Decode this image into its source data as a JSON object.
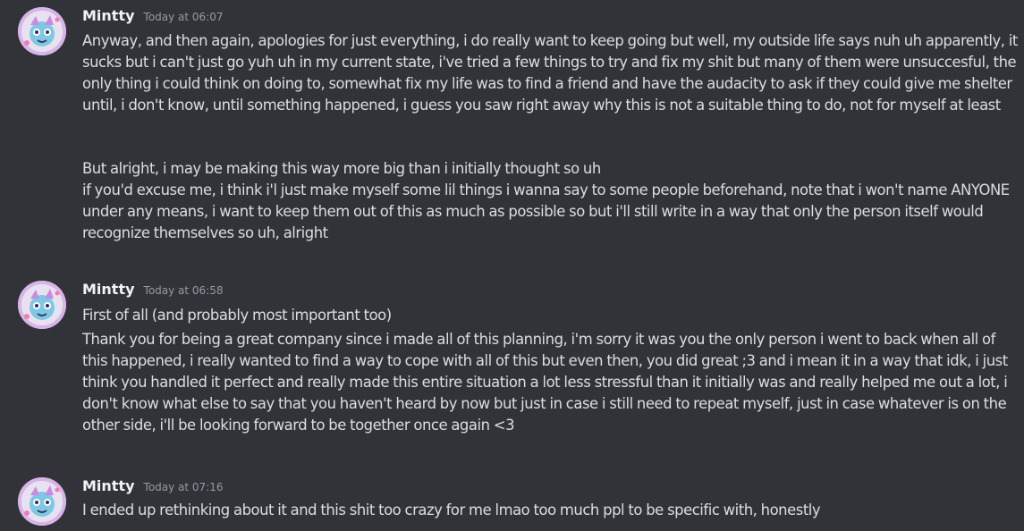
{
  "groups": [
    {
      "username": "Mintty",
      "timestamp": "Today at 06:07",
      "messages": [
        "Anyway, and then again, apologies for just everything, i do really want to keep going but well, my outside life says nuh uh apparently, it sucks but i can't just go yuh uh in my current state, i've tried a few things to try and fix my shit but many of them were unsuccesful, the only thing i could think on doing to, somewhat fix my life was to find a friend and have the audacity to ask if they could give me shelter until, i don't know, until something happened, i guess you saw right away why this is not a suitable thing to do, not for myself at least",
        "But alright, i may be making this way more big than i initially thought so uh",
        "if you'd excuse me, i think i'l just make myself some lil things i wanna say to some people beforehand, note that i won't name ANYONE under any means, i want to keep them out of this as much as possible so but i'll still write in a way that only the person itself would recognize themselves so uh, alright"
      ]
    },
    {
      "username": "Mintty",
      "timestamp": "Today at 06:58",
      "messages": [
        "First of all (and probably most important too)",
        "Thank you for being a great company since i made all of this planning, i'm sorry it was you the only person i went to back when all of this happened, i really wanted to find a way to cope with all of this but even then, you did great ;3 and i mean it in a way that idk, i just think you handled it perfect and really made this entire situation a lot less stressful than it initially was and really helped me out a lot, i don't know what else to say that you haven't heard by now but just in case i still need to repeat myself, just in case whatever is on the other side, i'll be looking forward to be together once again <3"
      ]
    },
    {
      "username": "Mintty",
      "timestamp": "Today at 07:16",
      "messages": [
        "I ended up rethinking about it and this shit too crazy for me lmao too much ppl to be specific with, honestly"
      ]
    }
  ],
  "avatar_icon": "user-avatar-icon",
  "colors": {
    "background": "#313338",
    "username": "#f2f3f5",
    "timestamp": "#949ba4",
    "text": "#dbdee1"
  }
}
